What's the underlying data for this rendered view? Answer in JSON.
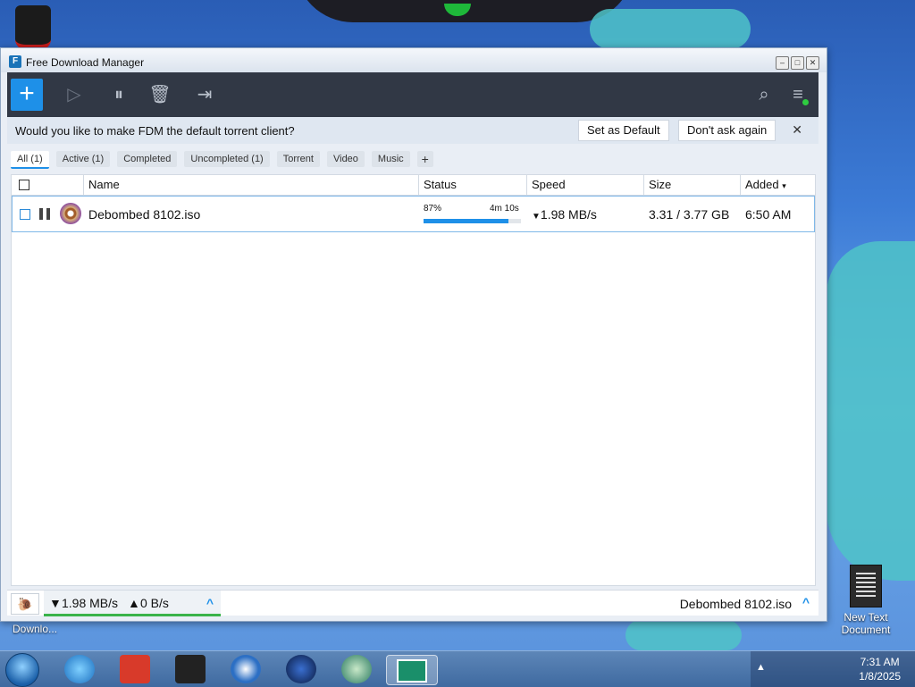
{
  "window": {
    "title": "Free Download Manager"
  },
  "banner": {
    "question": "Would you like to make FDM the default torrent client?",
    "set_default": "Set as Default",
    "dont_ask": "Don't ask again"
  },
  "tabs": [
    "All (1)",
    "Active (1)",
    "Completed",
    "Uncompleted (1)",
    "Torrent",
    "Video",
    "Music"
  ],
  "columns": {
    "name": "Name",
    "status": "Status",
    "speed": "Speed",
    "size": "Size",
    "added": "Added"
  },
  "download": {
    "name": "Debombed 8102.iso",
    "percent": "87%",
    "progress": 0.87,
    "remaining": "4m 10s",
    "speed": "1.98 MB/s",
    "size": "3.31 / 3.77 GB",
    "added": "6:50 AM"
  },
  "status_bar": {
    "down_speed": "1.98 MB/s",
    "up_speed": "0 B/s",
    "current_file": "Debombed 8102.iso"
  },
  "desktop": {
    "left_label": "Downlo...",
    "new_text_document": "New Text Document"
  },
  "taskbar": {
    "time": "7:31 AM",
    "date": "1/8/2025"
  },
  "colors": {
    "accent": "#1e90e8",
    "toolbar": "#313845",
    "speed_indicator": "#39b34a"
  }
}
